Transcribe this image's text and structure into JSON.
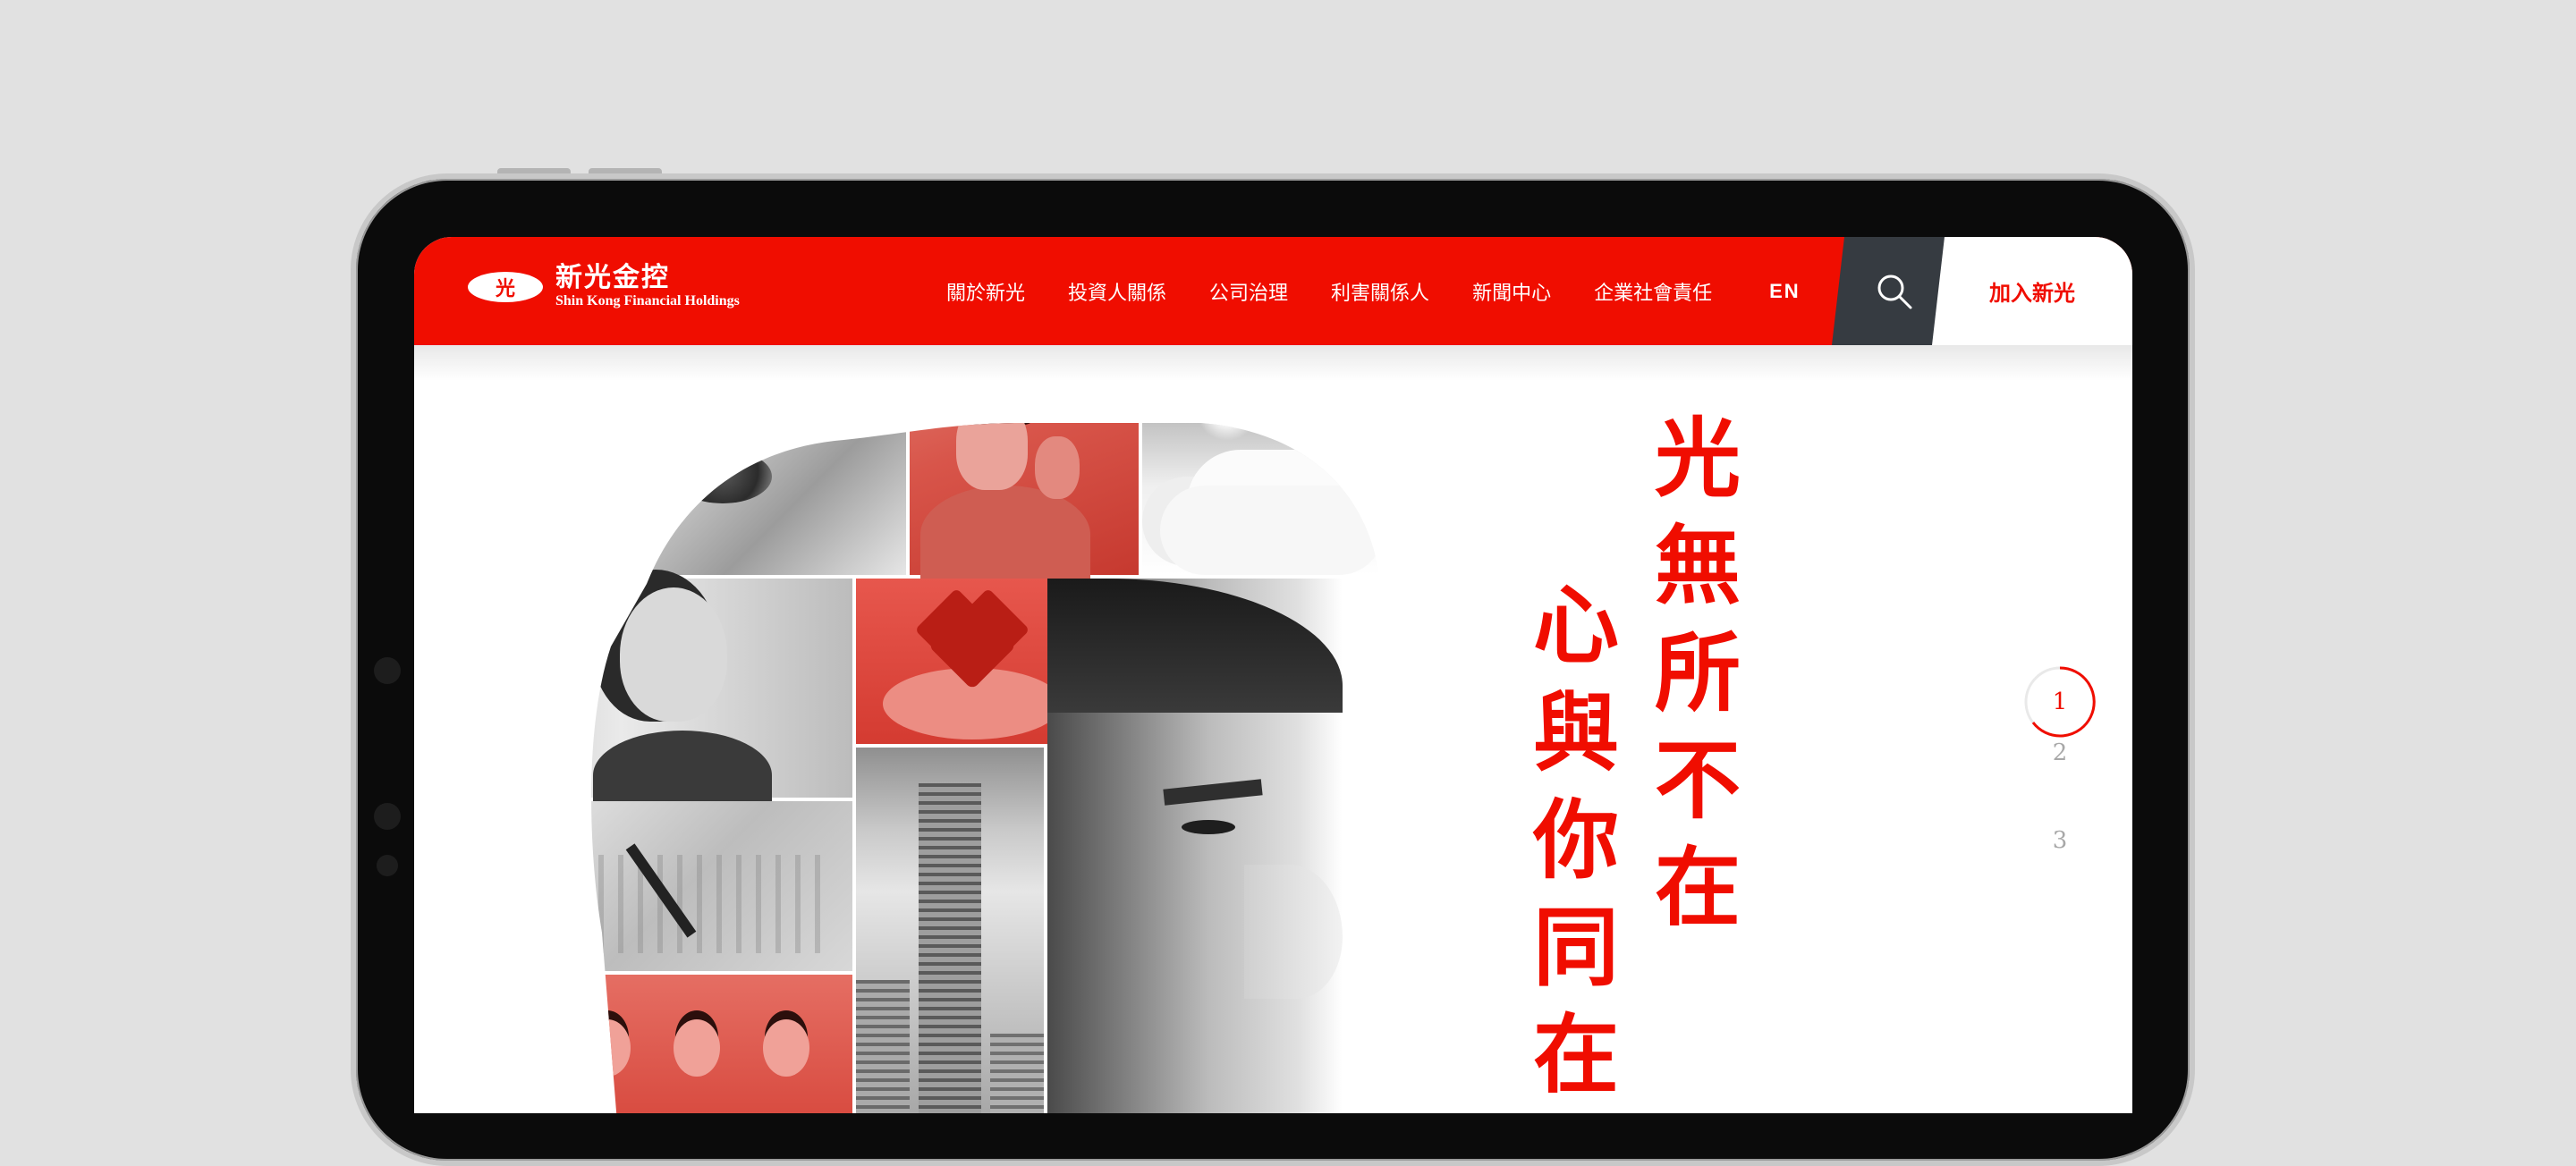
{
  "brand": {
    "logo_glyph": "光",
    "name_zh": "新光金控",
    "name_en": "Shin Kong Financial Holdings",
    "accent_color": "#f00d00",
    "dark_color": "#363b41"
  },
  "nav": {
    "items": [
      {
        "label": "關於新光"
      },
      {
        "label": "投資人關係"
      },
      {
        "label": "公司治理"
      },
      {
        "label": "利害關係人"
      },
      {
        "label": "新聞中心"
      },
      {
        "label": "企業社會責任"
      }
    ],
    "language": "EN",
    "search_icon": "search-icon",
    "join_label": "加入新光"
  },
  "hero": {
    "line1": [
      "光",
      "無",
      "所",
      "不",
      "在"
    ],
    "line2": [
      "心",
      "與",
      "你",
      "同",
      "在"
    ]
  },
  "pager": {
    "pages": [
      "1",
      "2",
      "3"
    ],
    "active": "1"
  }
}
